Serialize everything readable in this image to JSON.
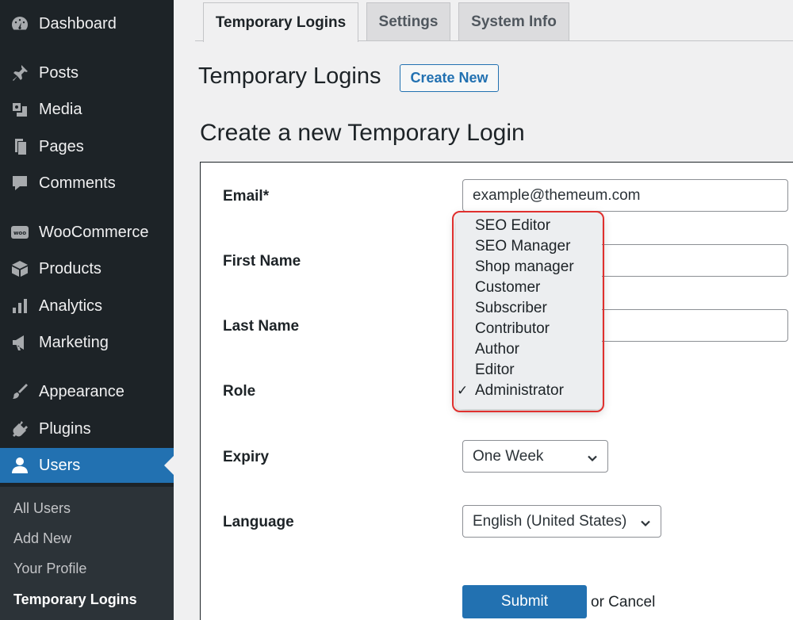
{
  "sidebar": {
    "items": [
      {
        "label": "Dashboard",
        "icon": "dashboard-icon"
      },
      {
        "label": "Posts",
        "icon": "pin-icon"
      },
      {
        "label": "Media",
        "icon": "media-icon"
      },
      {
        "label": "Pages",
        "icon": "pages-icon"
      },
      {
        "label": "Comments",
        "icon": "comment-icon"
      },
      {
        "label": "WooCommerce",
        "icon": "woo-icon"
      },
      {
        "label": "Products",
        "icon": "box-icon"
      },
      {
        "label": "Analytics",
        "icon": "bar-chart-icon"
      },
      {
        "label": "Marketing",
        "icon": "megaphone-icon"
      },
      {
        "label": "Appearance",
        "icon": "brush-icon"
      },
      {
        "label": "Plugins",
        "icon": "plug-icon"
      },
      {
        "label": "Users",
        "icon": "user-icon"
      }
    ],
    "submenu": [
      {
        "label": "All Users"
      },
      {
        "label": "Add New"
      },
      {
        "label": "Your Profile"
      },
      {
        "label": "Temporary Logins"
      }
    ]
  },
  "tabs": [
    {
      "label": "Temporary Logins"
    },
    {
      "label": "Settings"
    },
    {
      "label": "System Info"
    }
  ],
  "header": {
    "title": "Temporary Logins",
    "create_new": "Create New"
  },
  "form": {
    "title": "Create a new Temporary Login",
    "email_label": "Email*",
    "email_value": "example@themeum.com",
    "first_name_label": "First Name",
    "last_name_label": "Last Name",
    "role_label": "Role",
    "expiry_label": "Expiry",
    "expiry_value": "One Week",
    "language_label": "Language",
    "language_value": "English (United States)",
    "submit_label": "Submit",
    "cancel_text": "or Cancel"
  },
  "role_dropdown": {
    "options": [
      "SEO Editor",
      "SEO Manager",
      "Shop manager",
      "Customer",
      "Subscriber",
      "Contributor",
      "Author",
      "Editor",
      "Administrator"
    ],
    "selected": "Administrator",
    "check": "✓"
  },
  "colors": {
    "sidebar_bg": "#1d2327",
    "accent": "#2271b1",
    "highlight": "#e0302e"
  }
}
